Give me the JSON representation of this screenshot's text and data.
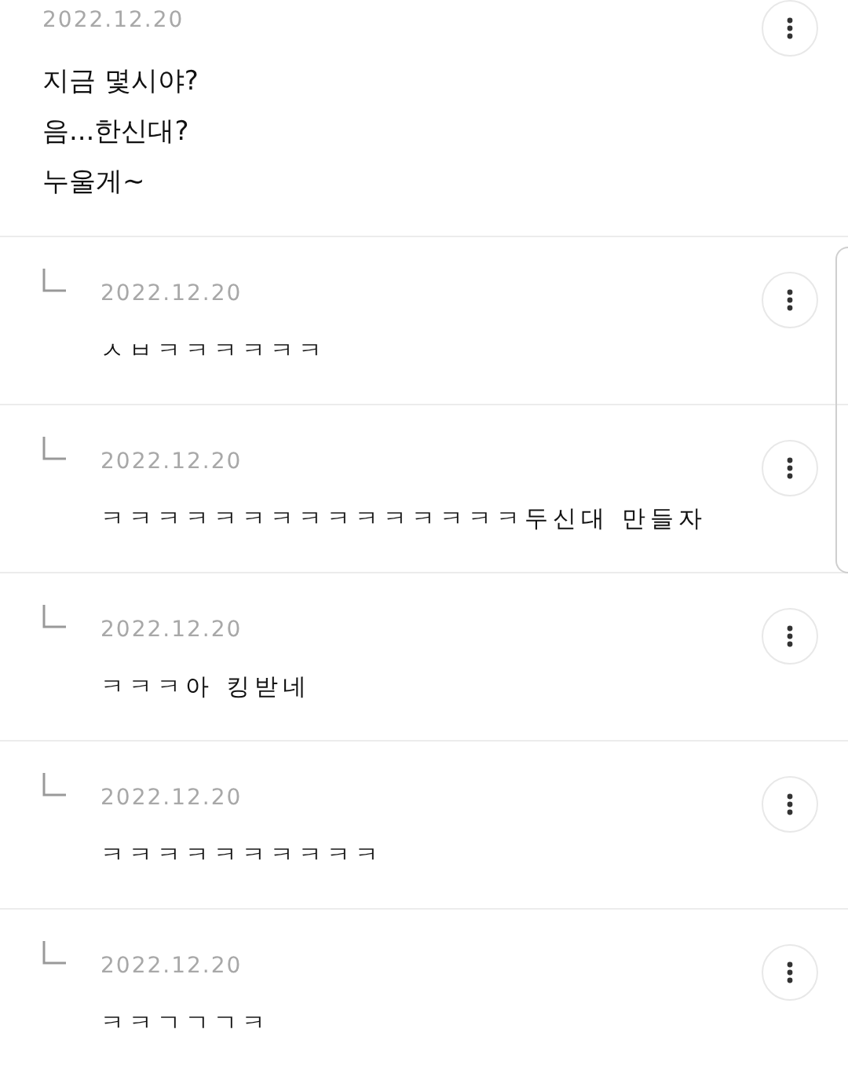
{
  "post": {
    "date": "2022.12.20",
    "lines": [
      "지금 몇시야?",
      "음...한신대?",
      "누울게~"
    ]
  },
  "replies": [
    {
      "date": "2022.12.20",
      "text": "ㅅㅂㅋㅋㅋㅋㅋㅋ"
    },
    {
      "date": "2022.12.20",
      "text": "ㅋㅋㅋㅋㅋㅋㅋㅋㅋㅋㅋㅋㅋㅋㅋ두신대 만들자"
    },
    {
      "date": "2022.12.20",
      "text": "ㅋㅋㅋ아 킹받네"
    },
    {
      "date": "2022.12.20",
      "text": "ㅋㅋㅋㅋㅋㅋㅋㅋㅋㅋ"
    },
    {
      "date": "2022.12.20",
      "text": "ㅋㅋㄱㄱㄱㅋ"
    }
  ]
}
